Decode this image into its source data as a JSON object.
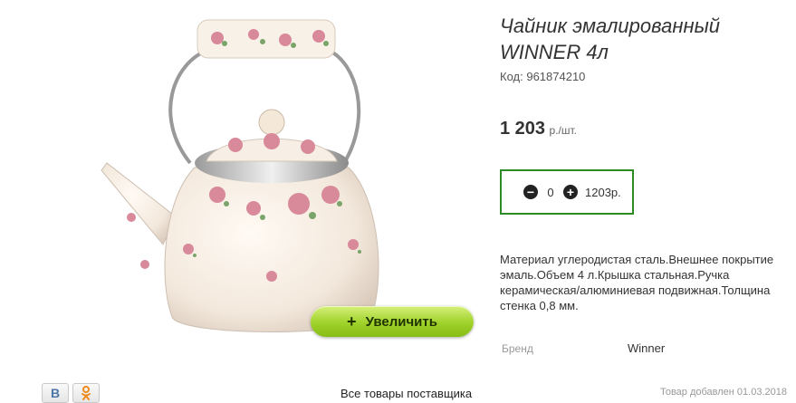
{
  "product": {
    "title": "Чайник эмалированный WINNER 4л",
    "code_label": "Код:",
    "code_value": "961874210",
    "price_amount": "1 203",
    "price_unit": "р./шт.",
    "description": "Материал углеродистая сталь.Внешнее покрытие эмаль.Объем 4 л.Крышка стальная.Ручка керамическая/алюминиевая подвижная.Толщина стенка 0,8 мм.",
    "brand_label": "Бренд",
    "brand_value": "Winner"
  },
  "quantity": {
    "minus_symbol": "−",
    "value": "0",
    "plus_symbol": "+",
    "total": "1203р."
  },
  "zoom_button": {
    "icon": "+",
    "label": "Увеличить"
  },
  "social": {
    "vk_label": "В"
  },
  "footer": {
    "all_goods_link": "Все товары поставщика",
    "added_date": "Товар добавлен 01.03.2018"
  },
  "colors": {
    "accent_green": "#2e8b23",
    "zoom_button_green": "#9fd22a",
    "kettle_cream": "#f5ece2",
    "rose_pink": "#d98a9a"
  },
  "icons": [
    "minus-circle-icon",
    "plus-circle-icon",
    "vk-icon",
    "odnoklassniki-icon",
    "plus-icon"
  ]
}
